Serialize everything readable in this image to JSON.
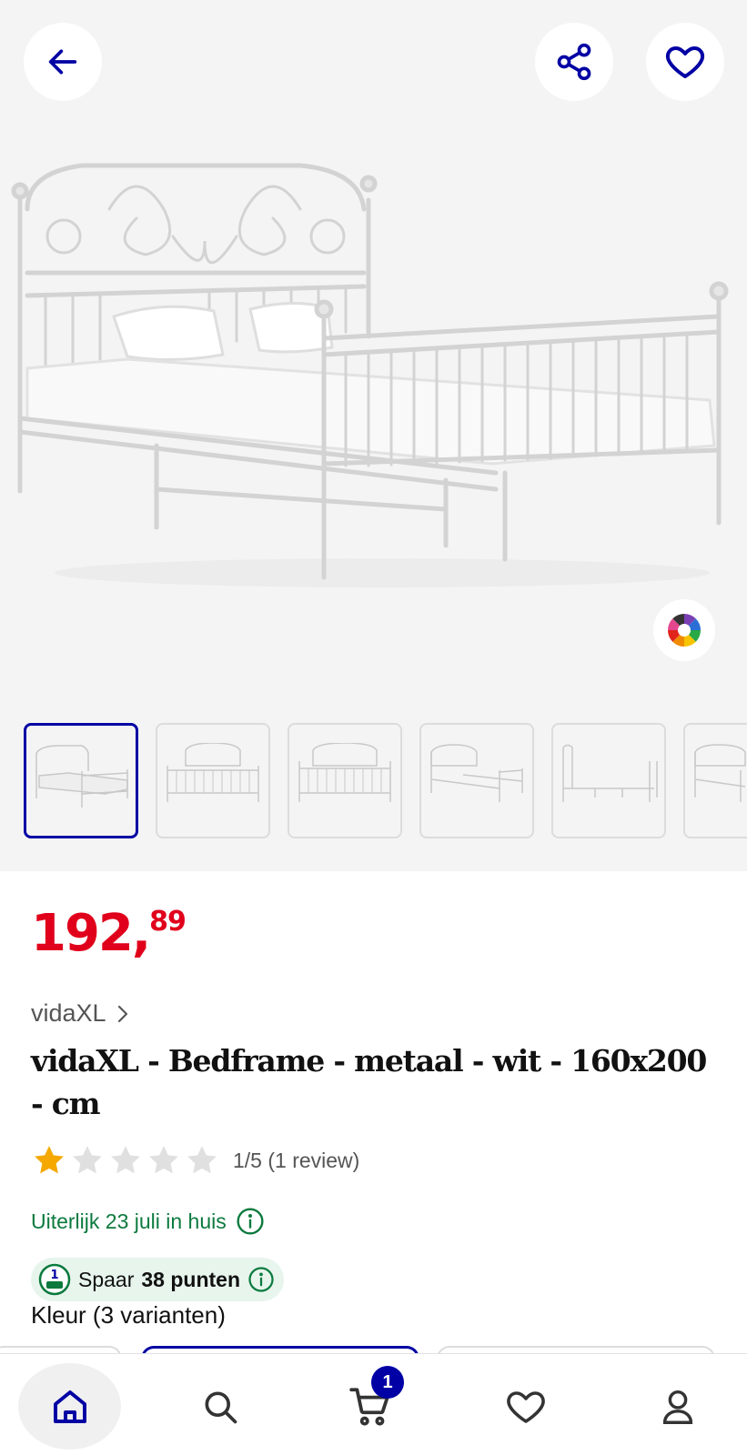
{
  "colors": {
    "accent": "#0000a4",
    "price": "#e0001b",
    "delivery": "#0c7a3e",
    "star_filled": "#f5a800",
    "star_empty": "#e0e0e0"
  },
  "header": {
    "back_icon": "arrow-left-icon",
    "share_icon": "share-icon",
    "favorite_icon": "heart-icon"
  },
  "gallery": {
    "thumbnail_count": 6,
    "active_index": 0,
    "color_variants_icon": "color-wheel-icon"
  },
  "product": {
    "price_main": "192,",
    "price_cents": "89",
    "brand": "vidaXL",
    "title": "vidaXL - Bedframe - metaal - wit - 160x200 - cm",
    "rating_value": 1,
    "rating_max": 5,
    "rating_text": "1/5 (1 review)",
    "delivery": "Uiterlijk 23 juli in huis",
    "points_prefix": "Spaar",
    "points_value": "38 punten",
    "points_number": "1",
    "variants_label": "Kleur (3 varianten)"
  },
  "bottom_nav": {
    "items": [
      "home-icon",
      "search-icon",
      "cart-icon",
      "heart-icon",
      "user-icon"
    ],
    "cart_count": "1"
  }
}
